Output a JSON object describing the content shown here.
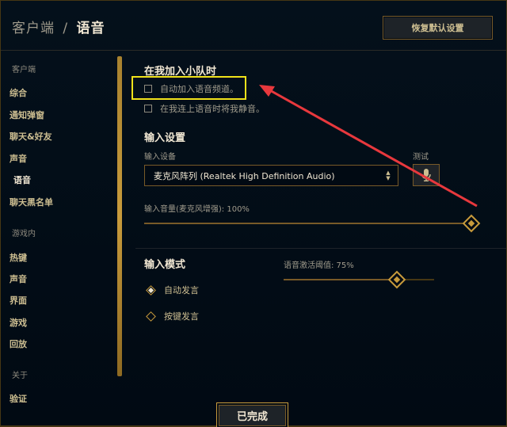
{
  "header": {
    "section": "客户端",
    "separator": "/",
    "current": "语音",
    "restore_label": "恢复默认设置"
  },
  "sidebar": {
    "client_section": "客户端",
    "client_items": [
      "综合",
      "通知弹窗",
      "聊天&好友",
      "声音",
      "语音",
      "聊天黑名单"
    ],
    "game_section": "游戏内",
    "game_items": [
      "热键",
      "声音",
      "界面",
      "游戏",
      "回放"
    ],
    "about_section": "关于",
    "about_items": [
      "验证"
    ],
    "active": "语音"
  },
  "party": {
    "title": "在我加入小队时",
    "auto_join_label": "自动加入语音频道。",
    "auto_join_checked": false,
    "mute_label": "在我连上语音时将我静音。",
    "mute_checked": false
  },
  "input_settings": {
    "title": "输入设置",
    "device_label": "输入设备",
    "device_value": "麦克风阵列 (Realtek High Definition Audio)",
    "test_label": "测试",
    "volume_label": "输入音量(麦克风增强): 100%",
    "volume_percent": 100
  },
  "input_mode": {
    "title": "输入模式",
    "options": [
      "自动发言",
      "按键发言"
    ],
    "selected": "自动发言",
    "threshold_label": "语音激活阈值: 75%",
    "threshold_percent": 75
  },
  "footer": {
    "done_label": "已完成"
  },
  "colors": {
    "gold": "#c89b3c",
    "text_light": "#f0e6d2",
    "text_muted": "#a09b8c",
    "highlight": "#f1e21a",
    "annotation_arrow": "#e8383d"
  }
}
